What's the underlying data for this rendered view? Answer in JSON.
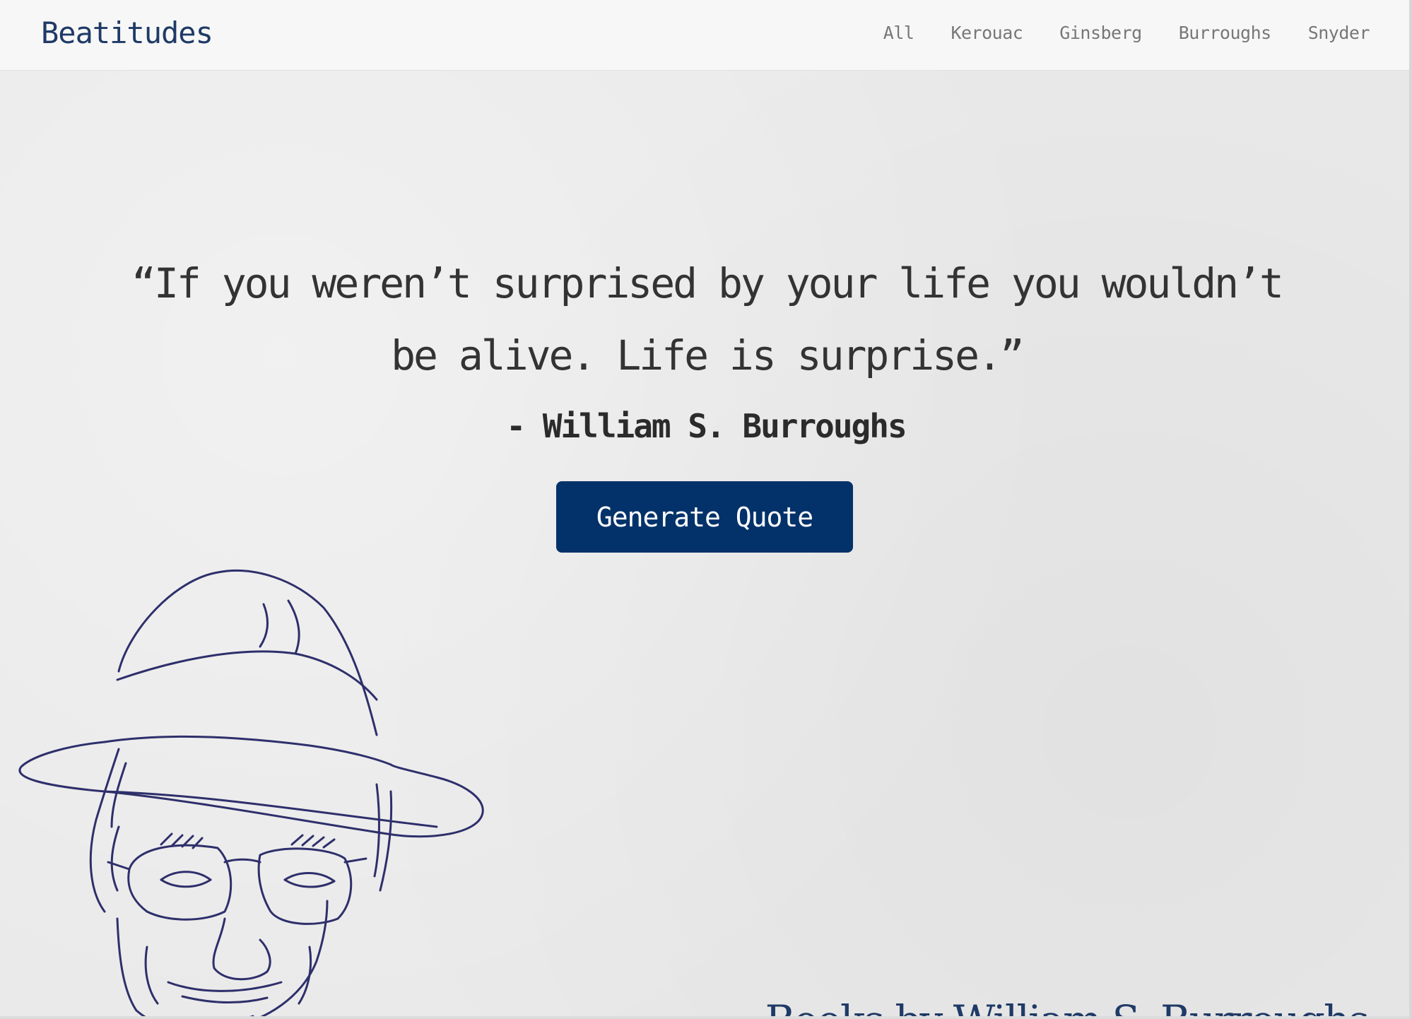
{
  "navbar": {
    "brand": "Beatitudes",
    "links": [
      "All",
      "Kerouac",
      "Ginsberg",
      "Burroughs",
      "Snyder"
    ]
  },
  "quote": {
    "text": "“If you weren’t surprised by your life you wouldn’t be alive. Life is surprise.”",
    "author": "- William S. Burroughs"
  },
  "generate_button": {
    "label": "Generate Quote"
  },
  "portrait": {
    "icon": "burroughs-portrait-line-drawing",
    "stroke_color": "#2e2f6b"
  },
  "books_link": {
    "label": "Books by William S. Burroughs"
  },
  "colors": {
    "navbar_bg": "#f7f7f7",
    "brand": "#1f3a66",
    "button_bg": "#03326a",
    "page_bg": "#e9e9e9",
    "quote_text": "#333333"
  }
}
